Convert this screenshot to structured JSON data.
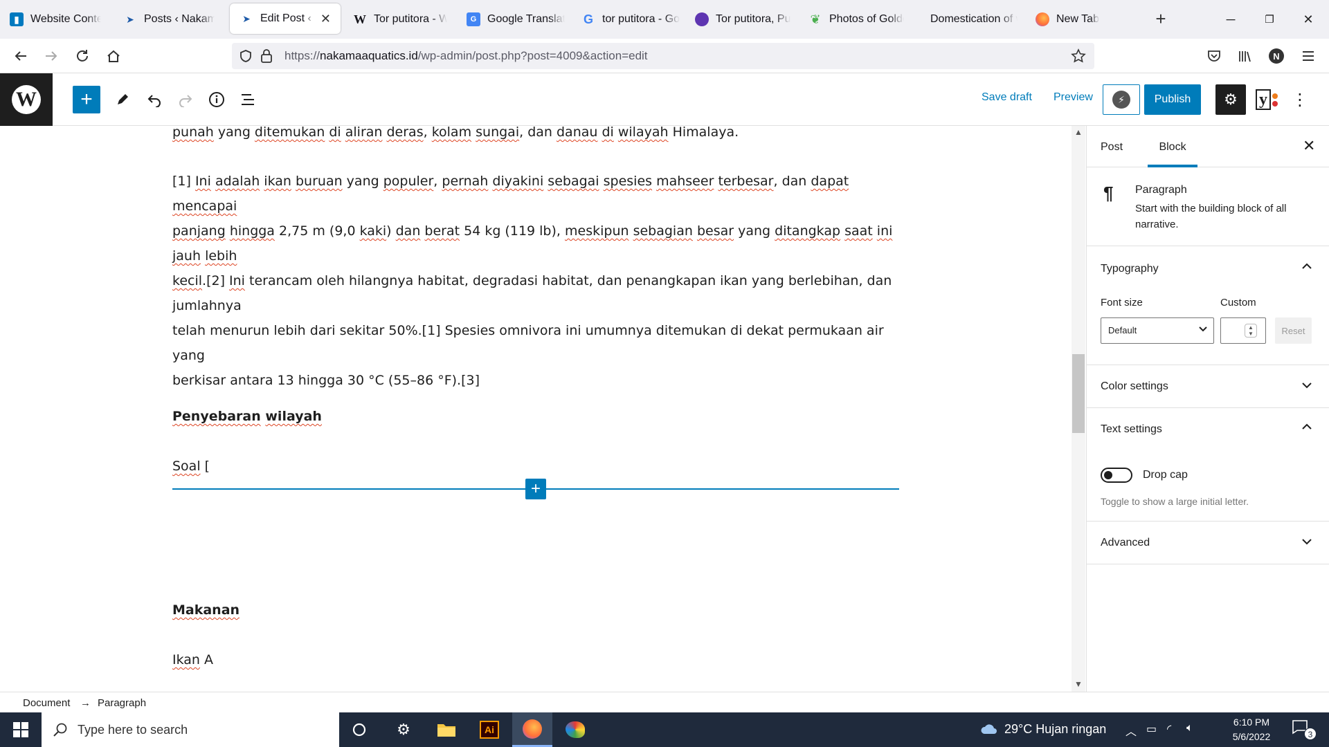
{
  "browser": {
    "tabs": [
      {
        "label": "Website Content",
        "icon": "trello-icon",
        "color": "#0079bf"
      },
      {
        "label": "Posts ‹ Nakama Aquatics",
        "icon": "fish-favicon-icon",
        "color": "#1d5aa8"
      },
      {
        "label": "Edit Post ‹ Nakama",
        "icon": "fish-favicon-icon",
        "color": "#1d5aa8",
        "active": true
      },
      {
        "label": "Tor putitora - Wikipedia",
        "icon": "wikipedia-icon",
        "color": "#000000"
      },
      {
        "label": "Google Translate",
        "icon": "google-translate-icon",
        "color": "#4285f4"
      },
      {
        "label": "tor putitora - Google",
        "icon": "google-icon",
        "color": "#4285f4"
      },
      {
        "label": "Tor putitora, Putitor",
        "icon": "globe-icon",
        "color": "#5e35b1"
      },
      {
        "label": "Photos of Golden Mahseer",
        "icon": "leaf-icon",
        "color": "#4caf50"
      },
      {
        "label": "Domestication of wild",
        "icon": "",
        "color": ""
      },
      {
        "label": "New Tab",
        "icon": "firefox-icon",
        "color": "#ff7139"
      }
    ],
    "url_prefix": "https://",
    "url_domain": "nakamaaquatics.id",
    "url_path": "/wp-admin/post.php?post=4009&action=edit",
    "profile_initial": "N"
  },
  "wp_toolbar": {
    "save_draft": "Save draft",
    "preview": "Preview",
    "publish": "Publish",
    "yoast_letter": "y"
  },
  "content": {
    "line0": [
      {
        "t": "punah",
        "s": 1
      },
      {
        "t": " yang "
      },
      {
        "t": "ditemukan",
        "s": 1
      },
      {
        "t": " "
      },
      {
        "t": "di",
        "s": 1
      },
      {
        "t": " "
      },
      {
        "t": "aliran",
        "s": 1
      },
      {
        "t": " "
      },
      {
        "t": "deras",
        "s": 1
      },
      {
        "t": ", "
      },
      {
        "t": "kolam",
        "s": 1
      },
      {
        "t": " "
      },
      {
        "t": "sungai",
        "s": 1
      },
      {
        "t": ", dan "
      },
      {
        "t": "danau",
        "s": 1
      },
      {
        "t": " "
      },
      {
        "t": "di",
        "s": 1
      },
      {
        "t": " "
      },
      {
        "t": "wilayah",
        "s": 1
      },
      {
        "t": " Himalaya."
      }
    ],
    "para": [
      [
        {
          "t": "[1] "
        },
        {
          "t": "Ini",
          "s": 1
        },
        {
          "t": " "
        },
        {
          "t": "adalah",
          "s": 1
        },
        {
          "t": " "
        },
        {
          "t": "ikan",
          "s": 1
        },
        {
          "t": " "
        },
        {
          "t": "buruan",
          "s": 1
        },
        {
          "t": " yang "
        },
        {
          "t": "populer",
          "s": 1
        },
        {
          "t": ", "
        },
        {
          "t": "pernah",
          "s": 1
        },
        {
          "t": " "
        },
        {
          "t": "diyakini",
          "s": 1
        },
        {
          "t": " "
        },
        {
          "t": "sebagai",
          "s": 1
        },
        {
          "t": " "
        },
        {
          "t": "spesies",
          "s": 1
        },
        {
          "t": " "
        },
        {
          "t": "mahseer",
          "s": 1
        },
        {
          "t": " "
        },
        {
          "t": "terbesar",
          "s": 1
        },
        {
          "t": ", dan "
        },
        {
          "t": "dapat",
          "s": 1
        },
        {
          "t": " "
        },
        {
          "t": "mencapai",
          "s": 1
        }
      ],
      [
        {
          "t": "panjang",
          "s": 1
        },
        {
          "t": " "
        },
        {
          "t": "hingga",
          "s": 1
        },
        {
          "t": " 2,75 m (9,0 "
        },
        {
          "t": "kaki",
          "s": 1
        },
        {
          "t": ") "
        },
        {
          "t": "dan",
          "s": 1
        },
        {
          "t": " "
        },
        {
          "t": "berat",
          "s": 1
        },
        {
          "t": " 54 kg (119 lb), "
        },
        {
          "t": "meskipun",
          "s": 1
        },
        {
          "t": " "
        },
        {
          "t": "sebagian",
          "s": 1
        },
        {
          "t": " "
        },
        {
          "t": "besar",
          "s": 1
        },
        {
          "t": " yang "
        },
        {
          "t": "ditangkap",
          "s": 1
        },
        {
          "t": " "
        },
        {
          "t": "saat",
          "s": 1
        },
        {
          "t": " "
        },
        {
          "t": "ini",
          "s": 1
        },
        {
          "t": " "
        },
        {
          "t": "jauh",
          "s": 1
        },
        {
          "t": " "
        },
        {
          "t": "lebih",
          "s": 1
        }
      ],
      [
        {
          "t": "kecil",
          "s": 1
        },
        {
          "t": ".[2] "
        },
        {
          "t": "Ini",
          "s": 1
        },
        {
          "t": " terancam oleh hilangnya habitat, degradasi habitat, dan penangkapan ikan yang berlebihan, dan jumlahnya"
        }
      ],
      [
        {
          "t": "telah menurun lebih dari sekitar 50%.[1] Spesies omnivora ini umumnya ditemukan di dekat permukaan air yang"
        }
      ],
      [
        {
          "t": "berkisar antara 13 hingga 30 °C (55–86 °F).[3]"
        }
      ]
    ],
    "heading1": [
      {
        "t": "Penyebaran",
        "s": 1
      },
      {
        "t": " "
      },
      {
        "t": "wilayah",
        "s": 1
      }
    ],
    "soal": [
      {
        "t": "Soal",
        "s": 1
      },
      {
        "t": " ["
      }
    ],
    "heading2": [
      {
        "t": "Makanan",
        "s": 1
      }
    ],
    "ikan": [
      {
        "t": "Ikan",
        "s": 1
      },
      {
        "t": " A"
      }
    ]
  },
  "sidebar": {
    "tab_post": "Post",
    "tab_block": "Block",
    "block_title": "Paragraph",
    "block_desc": "Start with the building block of all narrative.",
    "typography": "Typography",
    "font_size_label": "Font size",
    "custom_label": "Custom",
    "font_size_value": "Default",
    "reset": "Reset",
    "color_settings": "Color settings",
    "text_settings": "Text settings",
    "drop_cap": "Drop cap",
    "drop_cap_help": "Toggle to show a large initial letter.",
    "advanced": "Advanced"
  },
  "breadcrumb": {
    "document": "Document",
    "arrow": "→",
    "paragraph": "Paragraph"
  },
  "taskbar": {
    "search_placeholder": "Type here to search",
    "weather": "29°C  Hujan ringan",
    "time": "6:10 PM",
    "date": "5/6/2022",
    "notifications": "3",
    "ai_label": "Ai"
  },
  "colors": {
    "wp_blue": "#007cba",
    "spellcheck": "#dd4422",
    "taskbar": "#1f2a3c"
  }
}
